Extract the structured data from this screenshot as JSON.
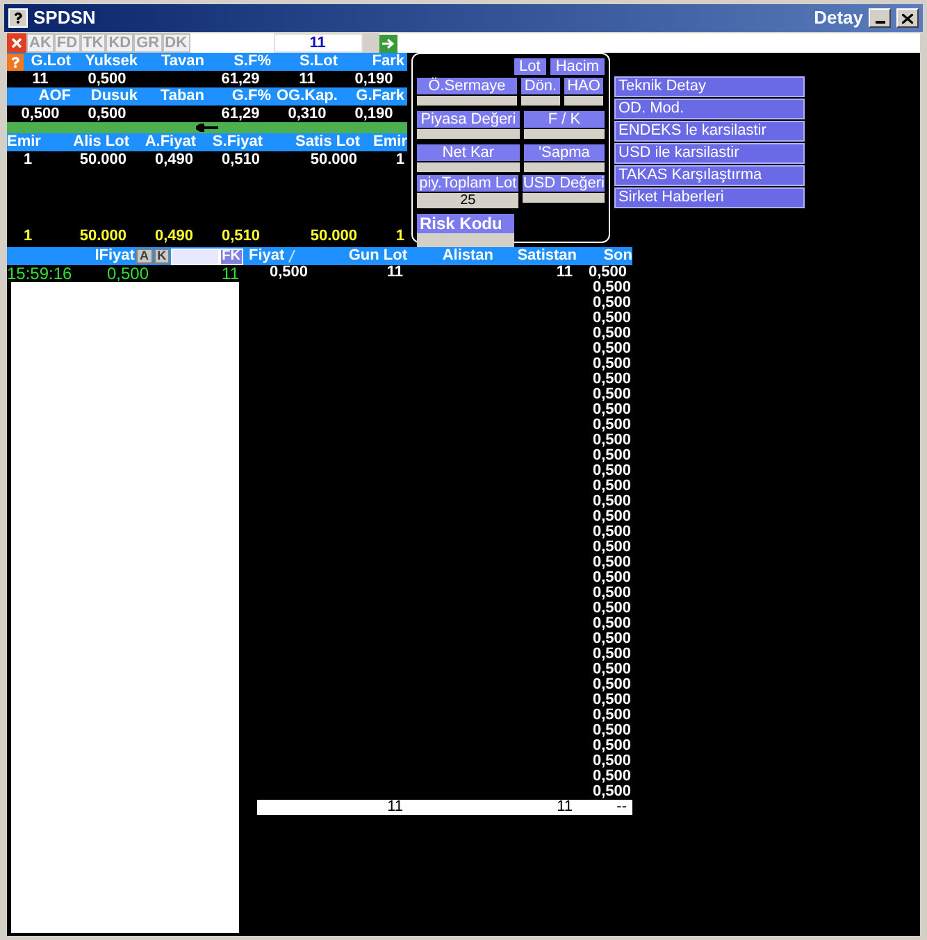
{
  "window": {
    "title": "SPDSN",
    "caption": "Detay"
  },
  "toolbar": {
    "buttons": [
      {
        "label": "AK",
        "disabled": true
      },
      {
        "label": "FD",
        "disabled": true
      },
      {
        "label": "TK",
        "disabled": true
      },
      {
        "label": "KD",
        "disabled": true
      },
      {
        "label": "GR",
        "disabled": true
      },
      {
        "label": "DK",
        "disabled": true
      }
    ],
    "quantity": "11"
  },
  "quote_rows": [
    {
      "columns": [
        {
          "label": "G.Lot",
          "value": "11"
        },
        {
          "label": "Yuksek",
          "value": "0,500"
        },
        {
          "label": "Tavan"
        },
        {
          "label": "S.F%",
          "value": "61,29"
        },
        {
          "label": "S.Lot",
          "value": "11"
        },
        {
          "label": "Fark",
          "value": "0,190"
        }
      ]
    },
    {
      "columns": [
        {
          "label": "AOF",
          "value": "0,500"
        },
        {
          "label": "Dusuk",
          "value": "0,500"
        },
        {
          "label": "Taban"
        },
        {
          "label": "G.F%",
          "value": "61,29"
        },
        {
          "label": "OG.Kap.",
          "value": "0,310"
        },
        {
          "label": "G.Fark",
          "value": "0,190"
        }
      ]
    }
  ],
  "depth": {
    "columns": [
      "Emir",
      "Alis Lot",
      "A.Fiyat",
      "S.Fiyat",
      "Satis Lot",
      "Emir"
    ],
    "rows": [
      {
        "kind": "level",
        "cells": [
          "1",
          "50.000",
          "0,490",
          "0,510",
          "50.000",
          "1"
        ]
      },
      {
        "kind": "total",
        "cells": [
          "1",
          "50.000",
          "0,490",
          "0,510",
          "50.000",
          "1"
        ]
      }
    ]
  },
  "fundamentals": {
    "toggles": [
      "Lot",
      "Hacim"
    ],
    "rows": [
      [
        {
          "label": "Ö.Sermaye"
        },
        {
          "label": "Dön."
        },
        {
          "label": "HAO"
        }
      ],
      [
        {
          "label": "Piyasa Değeri"
        },
        {
          "label": "F / K"
        }
      ],
      [
        {
          "label": "Net Kar"
        },
        {
          "label": "'Sapma"
        }
      ],
      [
        {
          "label": "piy.Toplam Lot",
          "value": "25"
        },
        {
          "label": "USD Değeri"
        }
      ]
    ],
    "risk_code": "Risk Kodu"
  },
  "menu": [
    "Teknik Detay",
    "OD. Mod.",
    "ENDEKS le karsilastir",
    "USD ile karsilastir",
    "TAKAS Karşılaştırma",
    "Sirket Haberleri"
  ],
  "trades": {
    "filter_label": "IFiyat",
    "filter_buttons": [
      "A",
      "K"
    ],
    "fk_button": "FK",
    "columns": [
      "Fiyat",
      "Gun Lot",
      "Alistan",
      "Satistan",
      "Son"
    ],
    "rows": [
      {
        "time": "15:59:16",
        "price": "0,500",
        "lot": "11",
        "fiyat": "0,500",
        "gun_lot": "11",
        "satistan": "11",
        "son": "0,500"
      }
    ],
    "son_values": [
      "0,500",
      "0,500",
      "0,500",
      "0,500",
      "0,500",
      "0,500",
      "0,500",
      "0,500",
      "0,500",
      "0,500",
      "0,500",
      "0,500",
      "0,500",
      "0,500",
      "0,500",
      "0,500",
      "0,500",
      "0,500",
      "0,500",
      "0,500",
      "0,500",
      "0,500",
      "0,500",
      "0,500",
      "0,500",
      "0,500",
      "0,500",
      "0,500",
      "0,500",
      "0,500",
      "0,500",
      "0,500",
      "0,500",
      "0,500"
    ],
    "totals": {
      "gun_lot": "11",
      "satistan": "11",
      "son": "--"
    }
  }
}
